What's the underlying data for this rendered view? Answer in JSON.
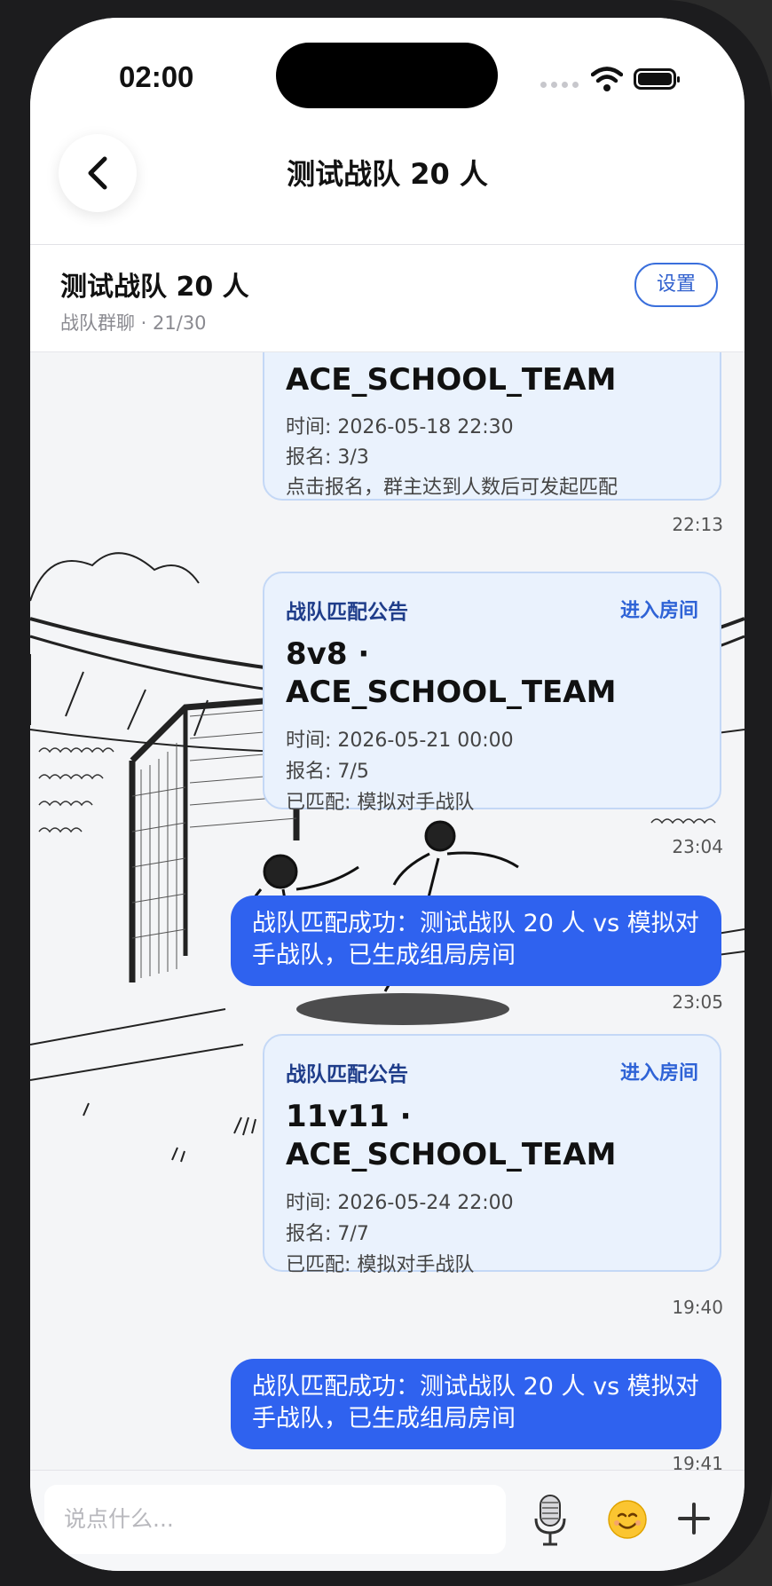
{
  "status_bar": {
    "time": "02:00"
  },
  "nav": {
    "title": "测试战队 20 人"
  },
  "group": {
    "title": "测试战队 20 人",
    "subtitle": "战队群聊 · 21/30",
    "settings_label": "设置"
  },
  "messages": [
    {
      "title": "ACE_SCHOOL_TEAM",
      "time_line": "时间: 2026-05-18 22:30",
      "signup_line": "报名: 3/3",
      "note_line": "点击报名，群主达到人数后可发起匹配",
      "timestamp": "22:13"
    },
    {
      "label": "战队匹配公告",
      "enter_label": "进入房间",
      "title_line1": "8v8 ·",
      "title_line2": "ACE_SCHOOL_TEAM",
      "time_line": "时间: 2026-05-21 00:00",
      "signup_line": "报名: 7/5",
      "matched_line": "已匹配: 模拟对手战队",
      "timestamp": "23:04"
    },
    {
      "text": "战队匹配成功：测试战队 20 人 vs 模拟对手战队，已生成组局房间",
      "timestamp": "23:05"
    },
    {
      "label": "战队匹配公告",
      "enter_label": "进入房间",
      "title_line1": "11v11 ·",
      "title_line2": "ACE_SCHOOL_TEAM",
      "time_line": "时间: 2026-05-24 22:00",
      "signup_line": "报名: 7/7",
      "matched_line": "已匹配: 模拟对手战队",
      "timestamp": "19:40"
    },
    {
      "text": "战队匹配成功：测试战队 20 人 vs 模拟对手战队，已生成组局房间",
      "timestamp": "19:41"
    }
  ],
  "input": {
    "placeholder": "说点什么..."
  },
  "icons": {
    "back": "chevron-left-icon",
    "mic": "microphone-icon",
    "emoji": "smiling-face-icon",
    "plus": "plus-icon"
  },
  "colors": {
    "accent": "#2f62ef",
    "card_bg": "#eaf2fd",
    "card_border": "#c4d8f6",
    "card_label": "#1f3d8a"
  }
}
